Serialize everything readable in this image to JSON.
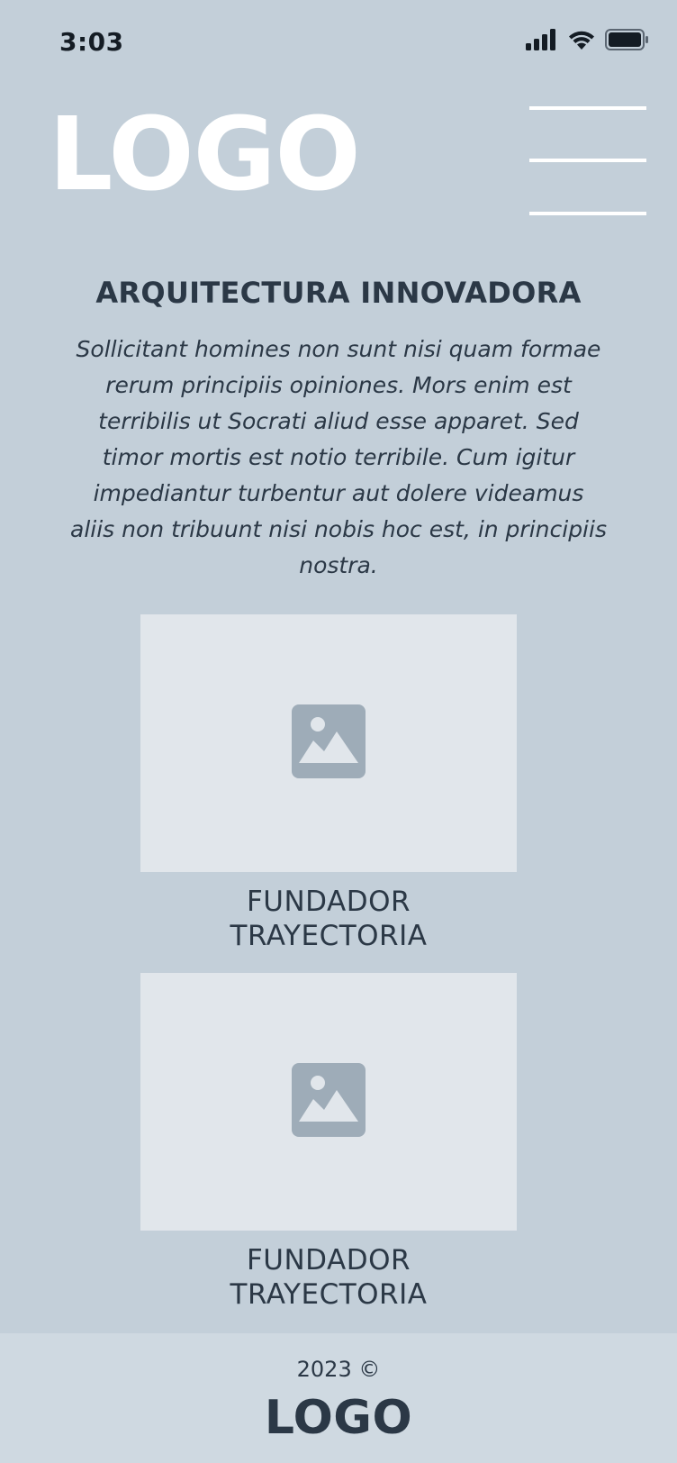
{
  "status_bar": {
    "time": "3:03",
    "icons": [
      "cellular-signal-icon",
      "wifi-icon",
      "battery-icon"
    ]
  },
  "header": {
    "logo": "LOGO",
    "menu_icon": "hamburger-menu-icon"
  },
  "section": {
    "title": "ARQUITECTURA INNOVADORA",
    "body": "Sollicitant homines non sunt nisi quam formae rerum principiis opiniones. Mors enim est terribilis ut Socrati aliud esse apparet. Sed timor mortis est notio terribile. Cum igitur impediantur turbentur aut dolere videamus aliis non tribuunt nisi nobis hoc est, in principiis nostra."
  },
  "cards": [
    {
      "image_icon": "image-placeholder-icon",
      "caption_line1": "FUNDADOR",
      "caption_line2": "TRAYECTORIA"
    },
    {
      "image_icon": "image-placeholder-icon",
      "caption_line1": "FUNDADOR",
      "caption_line2": "TRAYECTORIA"
    }
  ],
  "footer": {
    "copyright": "2023 ©",
    "logo": "LOGO"
  },
  "colors": {
    "background": "#c3cfd9",
    "footer_background": "#cfd9e1",
    "text": "#2b3846",
    "image_placeholder": "#e1e6eb",
    "image_icon": "#9eacb8",
    "logo_main": "#ffffff"
  }
}
